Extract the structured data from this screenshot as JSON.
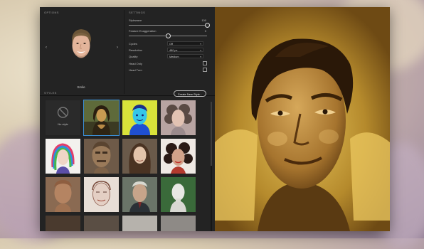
{
  "sections": {
    "options": "OPTIONS",
    "settings": "SETTINGS",
    "styles": "STYLES"
  },
  "face": {
    "name": "Smile",
    "prev_icon": "chevron-left-icon",
    "next_icon": "chevron-right-icon"
  },
  "settings": {
    "stylewave_label": "Stylewave",
    "stylewave_value": "100",
    "stylewave_level": 1.0,
    "feature_label": "Feature Exaggeration",
    "feature_value": "0",
    "feature_level": 0.5,
    "cycles_label": "Cycles",
    "cycles_value": "Off",
    "resolution_label": "Resolution",
    "resolution_value": "480 px",
    "quality_label": "Quality",
    "quality_value": "Medium",
    "head_only_label": "Head Only",
    "head_turn_label": "Head Turn"
  },
  "create_button": "Create New Style...",
  "no_style_label": "No style",
  "colors": {
    "selection": "#3b8fd6",
    "panel_bg": "#232323",
    "text": "#d6d6d6"
  }
}
